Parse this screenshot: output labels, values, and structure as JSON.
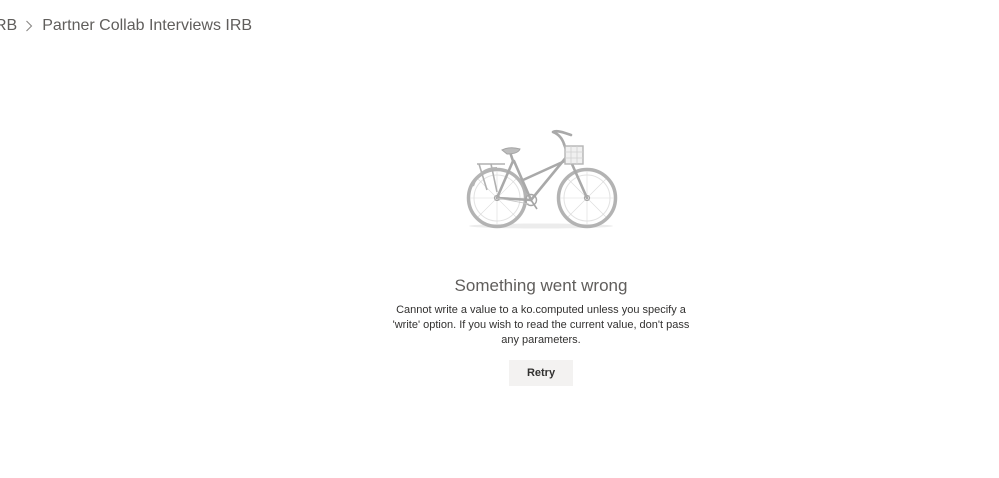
{
  "breadcrumb": {
    "items": [
      {
        "label": "RB"
      },
      {
        "label": "Partner Collab Interviews IRB"
      }
    ],
    "separator_icon": "chevron-right-icon"
  },
  "error": {
    "illustration_icon": "bicycle-icon",
    "title": "Something went wrong",
    "message": "Cannot write a value to a ko.computed unless you specify a 'write' option. If you wish to read the current value, don't pass any parameters.",
    "retry_label": "Retry"
  },
  "colors": {
    "text_primary": "#323130",
    "text_secondary": "#605e5c",
    "button_background": "#f3f2f1",
    "illustration_gray": "#b3b3b3"
  }
}
